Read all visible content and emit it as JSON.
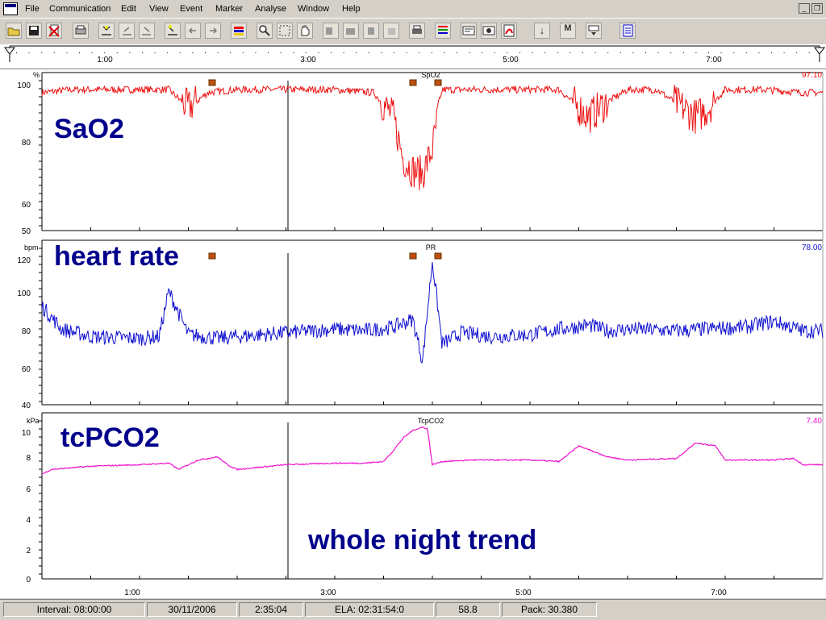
{
  "menu": [
    "File",
    "Communication",
    "Edit",
    "View",
    "Event",
    "Marker",
    "Analyse",
    "Window",
    "Help"
  ],
  "window_controls": {
    "minimize": "_",
    "restore": "❐"
  },
  "toolbar": {
    "icons": [
      "open-folder-icon",
      "save-icon",
      "delete-file-icon",
      "print-preview-icon",
      "marker-icon",
      "nav-left-icon",
      "nav-right-icon",
      "flag-icon",
      "step-back-icon",
      "step-forward-icon",
      "event-list-icon",
      "zoom-icon",
      "select-rect-icon",
      "hand-pan-icon",
      "align-left-icon",
      "align-grid-icon",
      "align-tool-icon",
      "align-extra-icon",
      "print-icon",
      "trend-lines-icon",
      "report-icon",
      "camera-icon",
      "pdf-icon",
      "down-arrow-icon",
      "marker-down-icon",
      "window-down-icon",
      "notes-icon"
    ],
    "marker_glyph": "M",
    "down_arrow": "↓"
  },
  "timeline": {
    "ticks": [
      "1:00",
      "3:00",
      "5:00",
      "7:00"
    ],
    "bottom_ticks": [
      "1:00",
      "3:00",
      "5:00",
      "7:00"
    ]
  },
  "panels": [
    {
      "id": "spo2",
      "unit": "%",
      "channel": "SpO2",
      "current": "97.10",
      "name": "SaO2",
      "color": "#ee1111",
      "y_ticks": [
        "100",
        "80",
        "60",
        "50"
      ]
    },
    {
      "id": "pr",
      "unit": "bpm",
      "channel": "PR",
      "current": "78.00",
      "name": "heart rate",
      "color": "#1010d0",
      "y_ticks": [
        "120",
        "100",
        "80",
        "60",
        "40"
      ]
    },
    {
      "id": "tcpco2",
      "unit": "kPa",
      "channel": "TcpCO2",
      "current": "7.40",
      "name": "tcPCO2",
      "color": "#ee11cc",
      "y_ticks": [
        "10",
        "8",
        "6",
        "4",
        "2",
        "0"
      ]
    }
  ],
  "annotation": "whole night trend",
  "status": [
    "Interval: 08:00:00",
    "30/11/2006",
    "2:35:04",
    "ELA: 02:31:54:0",
    "58.8",
    "Pack: 30.380"
  ],
  "chart_data": [
    {
      "type": "line",
      "title": "SpO2",
      "ylabel": "%",
      "ylim": [
        50,
        100
      ],
      "x_unit": "hours",
      "x_ticks": [
        "1:00",
        "3:00",
        "5:00",
        "7:00"
      ],
      "series": [
        {
          "name": "SpO2",
          "x": [
            0,
            0.3,
            0.6,
            1.0,
            1.3,
            1.5,
            1.7,
            2.0,
            2.5,
            3.0,
            3.4,
            3.6,
            3.7,
            3.8,
            3.9,
            4.0,
            4.1,
            4.3,
            4.7,
            5.0,
            5.3,
            5.6,
            5.8,
            6.0,
            6.3,
            6.7,
            6.8,
            7.0,
            7.4,
            7.8
          ],
          "y": [
            96,
            97,
            97,
            97,
            97,
            91,
            96,
            97,
            97,
            97,
            96,
            88,
            74,
            70,
            69,
            77,
            97,
            97,
            97,
            97,
            97,
            88,
            93,
            97,
            97,
            88,
            90,
            97,
            97,
            96
          ]
        }
      ]
    },
    {
      "type": "line",
      "title": "PR",
      "ylabel": "bpm",
      "ylim": [
        40,
        120
      ],
      "x_unit": "hours",
      "x_ticks": [
        "1:00",
        "3:00",
        "5:00",
        "7:00"
      ],
      "series": [
        {
          "name": "PR",
          "x": [
            0,
            0.2,
            0.5,
            1.0,
            1.2,
            1.3,
            1.5,
            1.8,
            2.0,
            2.5,
            3.0,
            3.3,
            3.6,
            3.8,
            3.9,
            4.0,
            4.1,
            4.3,
            4.6,
            5.0,
            5.3,
            5.6,
            5.8,
            6.0,
            6.5,
            6.8,
            7.2,
            7.5,
            7.8
          ],
          "y": [
            92,
            80,
            76,
            75,
            76,
            100,
            77,
            75,
            76,
            78,
            80,
            79,
            81,
            85,
            63,
            116,
            72,
            78,
            76,
            77,
            80,
            82,
            79,
            80,
            79,
            80,
            81,
            84,
            79
          ]
        }
      ]
    },
    {
      "type": "line",
      "title": "TcpCO2",
      "ylabel": "kPa",
      "ylim": [
        0,
        10
      ],
      "x_unit": "hours",
      "x_ticks": [
        "1:00",
        "3:00",
        "5:00",
        "7:00"
      ],
      "series": [
        {
          "name": "TcpCO2",
          "x": [
            0,
            0.1,
            0.5,
            1.0,
            1.3,
            1.4,
            1.6,
            1.8,
            1.9,
            2.0,
            2.5,
            3.0,
            3.3,
            3.5,
            3.6,
            3.7,
            3.8,
            3.9,
            3.95,
            4.0,
            4.1,
            4.4,
            4.7,
            5.0,
            5.3,
            5.5,
            5.8,
            6.0,
            6.5,
            6.7,
            6.9,
            7.0,
            7.3,
            7.5,
            7.7,
            7.8
          ],
          "y": [
            6.7,
            7.0,
            7.2,
            7.3,
            7.4,
            7.0,
            7.6,
            7.8,
            7.3,
            7.0,
            7.3,
            7.4,
            7.4,
            7.5,
            8.2,
            9.0,
            9.5,
            9.7,
            9.6,
            7.3,
            7.5,
            7.6,
            7.6,
            7.6,
            7.5,
            8.5,
            7.8,
            7.6,
            7.7,
            8.7,
            8.5,
            7.6,
            7.6,
            7.6,
            7.7,
            7.3
          ]
        }
      ]
    }
  ]
}
